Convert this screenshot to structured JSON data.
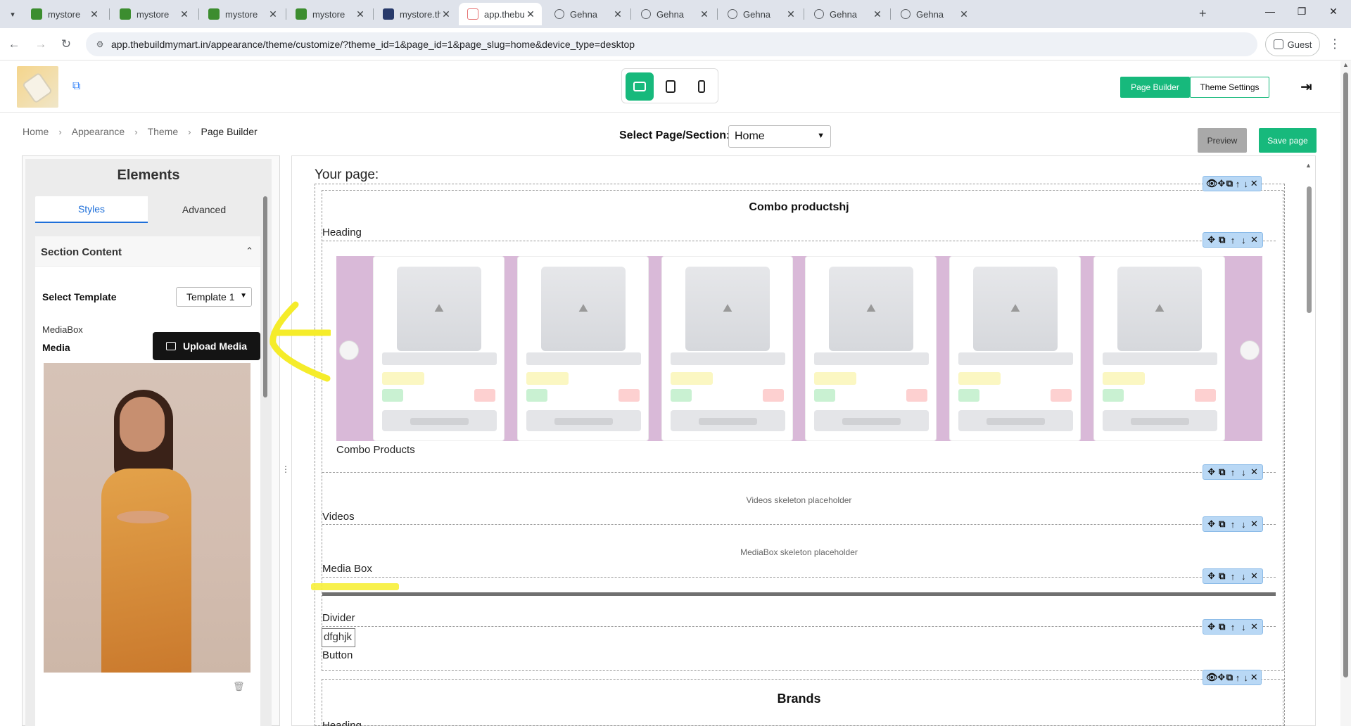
{
  "browser": {
    "tabs": [
      {
        "title": "mystore",
        "favicon": "green-store-icon"
      },
      {
        "title": "mystore",
        "favicon": "green-store-icon"
      },
      {
        "title": "mystore",
        "favicon": "green-store-icon"
      },
      {
        "title": "mystore",
        "favicon": "green-store-icon"
      },
      {
        "title": "mystore.thebu",
        "favicon": "dark-site-icon"
      },
      {
        "title": "app.thebuildm",
        "favicon": "pink-site-icon",
        "active": true
      },
      {
        "title": "Gehna",
        "favicon": "globe-icon"
      },
      {
        "title": "Gehna",
        "favicon": "globe-icon"
      },
      {
        "title": "Gehna",
        "favicon": "globe-icon"
      },
      {
        "title": "Gehna",
        "favicon": "globe-icon"
      },
      {
        "title": "Gehna",
        "favicon": "globe-icon"
      }
    ],
    "close_glyph": "✕",
    "new_tab_glyph": "+",
    "url": "app.thebuildmymart.in/appearance/theme/customize/?theme_id=1&page_id=1&page_slug=home&device_type=desktop",
    "profile_label": "Guest"
  },
  "header": {
    "page_builder_label": "Page Builder",
    "theme_settings_label": "Theme Settings",
    "accent_color": "#17b97c"
  },
  "breadcrumb": [
    "Home",
    "Appearance",
    "Theme",
    "Page Builder"
  ],
  "toolbar": {
    "select_page_label": "Select Page/Section:",
    "select_page_value": "Home",
    "preview_label": "Preview",
    "save_label": "Save page"
  },
  "elements_panel": {
    "title": "Elements",
    "tabs": [
      "Styles",
      "Advanced"
    ],
    "section_title": "Section Content",
    "select_template_label": "Select Template",
    "template_value": "Template 1",
    "mediabox_label": "MediaBox",
    "media_label": "Media",
    "upload_label": "Upload Media"
  },
  "canvas": {
    "your_page_label": "Your page:",
    "section1": {
      "heading": "Combo productshj",
      "heading_label": "Heading",
      "products_label": "Combo Products",
      "videos_placeholder": "Videos skeleton placeholder",
      "videos_label": "Videos",
      "mediabox_placeholder": "MediaBox skeleton placeholder",
      "mediabox_label": "Media Box",
      "divider_label": "Divider",
      "button_text": "dfghjk",
      "button_label": "Button"
    },
    "section2": {
      "heading": "Brands",
      "heading_label": "Heading"
    },
    "product_card_count": 6,
    "carousel_color": "#d9b9d8"
  }
}
